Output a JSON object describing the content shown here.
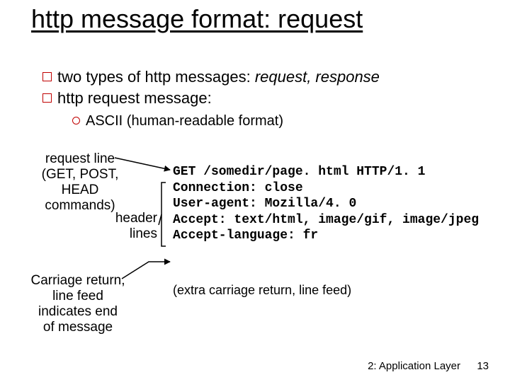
{
  "title": "http message format: request",
  "bullets": {
    "b1_pre": "two types of http messages: ",
    "b1_em": "request, response",
    "b2": "http request message:",
    "sub": "ASCII (human-readable format)"
  },
  "labels": {
    "request_line_1": "request line",
    "request_line_2": "(GET, POST,",
    "request_line_3": "HEAD commands)",
    "header_lines_1": "header",
    "header_lines_2": "lines",
    "cr_lf_1": "Carriage return,",
    "cr_lf_2": "line feed",
    "cr_lf_3": "indicates end",
    "cr_lf_4": "of message"
  },
  "code": {
    "l1": "GET /somedir/page. html HTTP/1. 1",
    "l2": "Connection: close",
    "l3": "User-agent: Mozilla/4. 0",
    "l4": "Accept: text/html, image/gif, image/jpeg",
    "l5": "Accept-language: fr"
  },
  "extra_note": "(extra carriage return, line feed)",
  "footer": {
    "text": "2: Application Layer",
    "page": "13"
  }
}
